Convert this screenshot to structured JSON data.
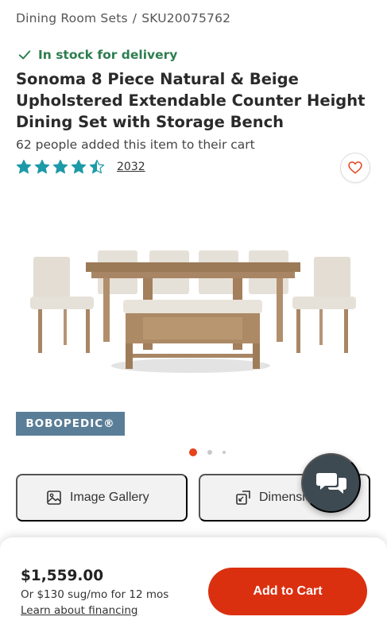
{
  "breadcrumb": {
    "category": "Dining Room Sets",
    "separator": "/",
    "sku": "SKU20075762"
  },
  "stock": {
    "label": "In stock for delivery",
    "icon": "check-icon",
    "color": "#2e7d4f"
  },
  "product": {
    "title": "Sonoma 8 Piece Natural & Beige Upholstered Extendable Counter Height Dining Set with Storage Bench",
    "cart_count_text": "62 people added this item to their cart",
    "rating_stars": 4.5,
    "review_count": "2032",
    "star_color": "#1d9aa8"
  },
  "wishlist": {
    "icon": "heart-icon",
    "color": "#e4431e"
  },
  "brand_badge": "BOBOPEDIC®",
  "carousel": {
    "active_index": 0,
    "dot_count": 3,
    "accent": "#e4431e"
  },
  "features": [
    {
      "label": "Image Gallery",
      "icon": "image-icon"
    },
    {
      "label": "Dimensions",
      "icon": "dimensions-icon"
    }
  ],
  "chat": {
    "icon": "chat-bubbles-icon"
  },
  "purchase": {
    "price": "$1,559.00",
    "monthly": "Or $130 sug/mo for 12 mos",
    "financing_link": "Learn about financing",
    "add_to_cart": "Add to Cart",
    "button_color": "#db3010"
  }
}
